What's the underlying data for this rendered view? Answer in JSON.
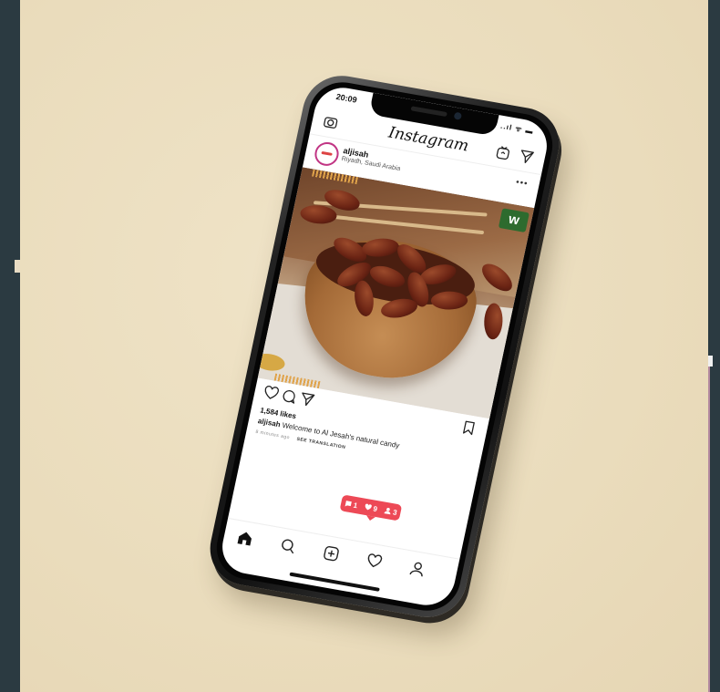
{
  "status_bar": {
    "time": "20:09",
    "icons": "..ıl ᯤ ▬"
  },
  "app": {
    "title": "Instagram"
  },
  "post": {
    "username": "aljisah",
    "location": "Riyadh, Saudi Arabia",
    "more_label": "•••",
    "sticker_text": "w",
    "likes": "1,584 likes",
    "caption_user": "aljisah",
    "caption_text": "Welcome to Al Jesah's natural candy",
    "meta_time": "8 minutes ago",
    "see_translation": "SEE TRANSLATION"
  },
  "activity": {
    "posts": "1",
    "likes": "9",
    "followers": "3"
  },
  "icons": {
    "camera": "camera-icon",
    "igtv": "igtv-icon",
    "direct": "direct-message-icon",
    "like": "heart-icon",
    "comment": "comment-icon",
    "share": "share-icon",
    "save": "bookmark-icon",
    "home": "home-icon",
    "search": "search-icon",
    "add": "add-post-icon",
    "activity": "activity-heart-icon",
    "profile": "profile-icon"
  },
  "colors": {
    "background": "#eadcbc",
    "notification": "#ed4956",
    "sticker": "#2d6b2e",
    "frame": "#2a3a42"
  }
}
